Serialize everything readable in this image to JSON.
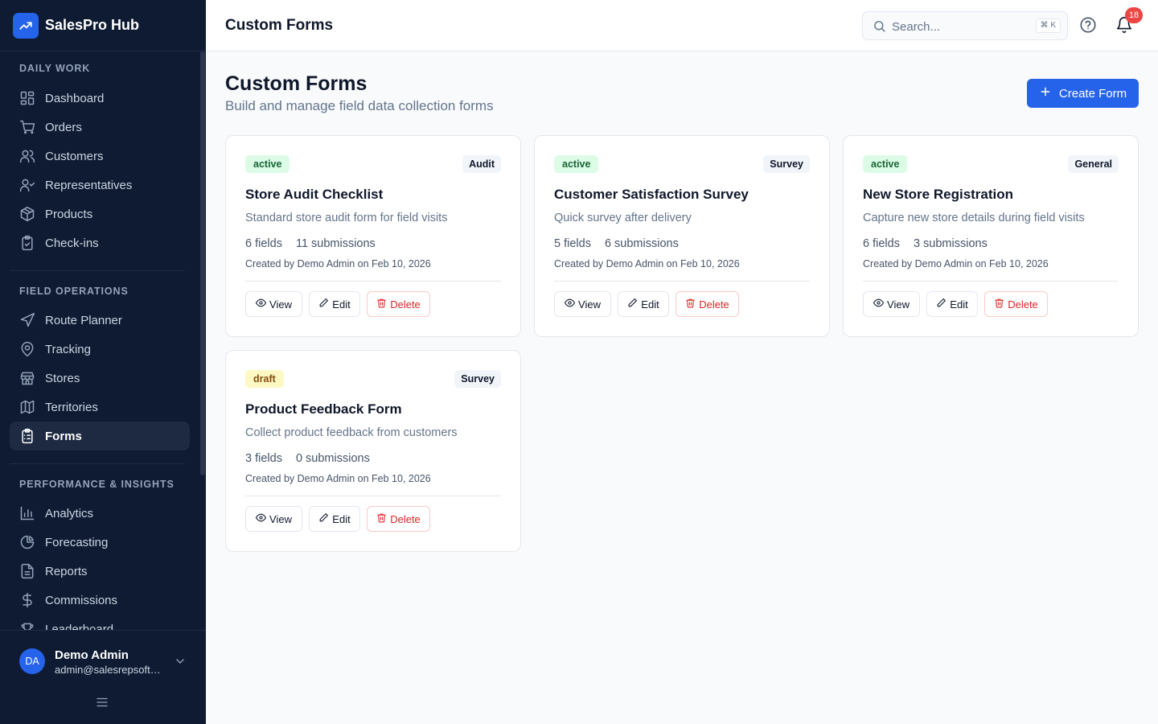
{
  "app": {
    "name": "SalesPro Hub"
  },
  "sidebar": {
    "sections": [
      {
        "title": "DAILY WORK",
        "items": [
          {
            "label": "Dashboard",
            "icon": "dashboard-icon"
          },
          {
            "label": "Orders",
            "icon": "cart-icon"
          },
          {
            "label": "Customers",
            "icon": "users-icon"
          },
          {
            "label": "Representatives",
            "icon": "user-check-icon"
          },
          {
            "label": "Products",
            "icon": "package-icon"
          },
          {
            "label": "Check-ins",
            "icon": "clipboard-check-icon"
          }
        ]
      },
      {
        "title": "FIELD OPERATIONS",
        "items": [
          {
            "label": "Route Planner",
            "icon": "navigation-icon"
          },
          {
            "label": "Tracking",
            "icon": "map-pin-icon"
          },
          {
            "label": "Stores",
            "icon": "store-icon"
          },
          {
            "label": "Territories",
            "icon": "map-icon"
          },
          {
            "label": "Forms",
            "icon": "clipboard-list-icon",
            "active": true
          }
        ]
      },
      {
        "title": "PERFORMANCE & INSIGHTS",
        "items": [
          {
            "label": "Analytics",
            "icon": "bar-chart-icon"
          },
          {
            "label": "Forecasting",
            "icon": "chart-pie-icon"
          },
          {
            "label": "Reports",
            "icon": "file-text-icon"
          },
          {
            "label": "Commissions",
            "icon": "dollar-icon"
          },
          {
            "label": "Leaderboard",
            "icon": "trophy-icon"
          }
        ]
      }
    ]
  },
  "user": {
    "initials": "DA",
    "name": "Demo Admin",
    "email": "admin@salesrepsoftware.com"
  },
  "header": {
    "title": "Custom Forms",
    "search_placeholder": "Search...",
    "search_shortcut": "⌘ K",
    "notification_count": "18"
  },
  "main": {
    "title": "Custom Forms",
    "subtitle": "Build and manage field data collection forms",
    "create_label": "Create Form"
  },
  "colors": {
    "accent": "#2563eb",
    "sidebar_bg": "#0f1b33",
    "danger": "#dc2626",
    "badge": "#ef4444"
  },
  "forms": [
    {
      "status": "active",
      "category": "Audit",
      "title": "Store Audit Checklist",
      "description": "Standard store audit form for field visits",
      "fields": "6 fields",
      "submissions": "11 submissions",
      "meta": "Created by Demo Admin on Feb 10, 2026"
    },
    {
      "status": "active",
      "category": "Survey",
      "title": "Customer Satisfaction Survey",
      "description": "Quick survey after delivery",
      "fields": "5 fields",
      "submissions": "6 submissions",
      "meta": "Created by Demo Admin on Feb 10, 2026"
    },
    {
      "status": "active",
      "category": "General",
      "title": "New Store Registration",
      "description": "Capture new store details during field visits",
      "fields": "6 fields",
      "submissions": "3 submissions",
      "meta": "Created by Demo Admin on Feb 10, 2026"
    },
    {
      "status": "draft",
      "category": "Survey",
      "title": "Product Feedback Form",
      "description": "Collect product feedback from customers",
      "fields": "3 fields",
      "submissions": "0 submissions",
      "meta": "Created by Demo Admin on Feb 10, 2026"
    }
  ],
  "card_actions": {
    "view": "View",
    "edit": "Edit",
    "delete": "Delete"
  }
}
